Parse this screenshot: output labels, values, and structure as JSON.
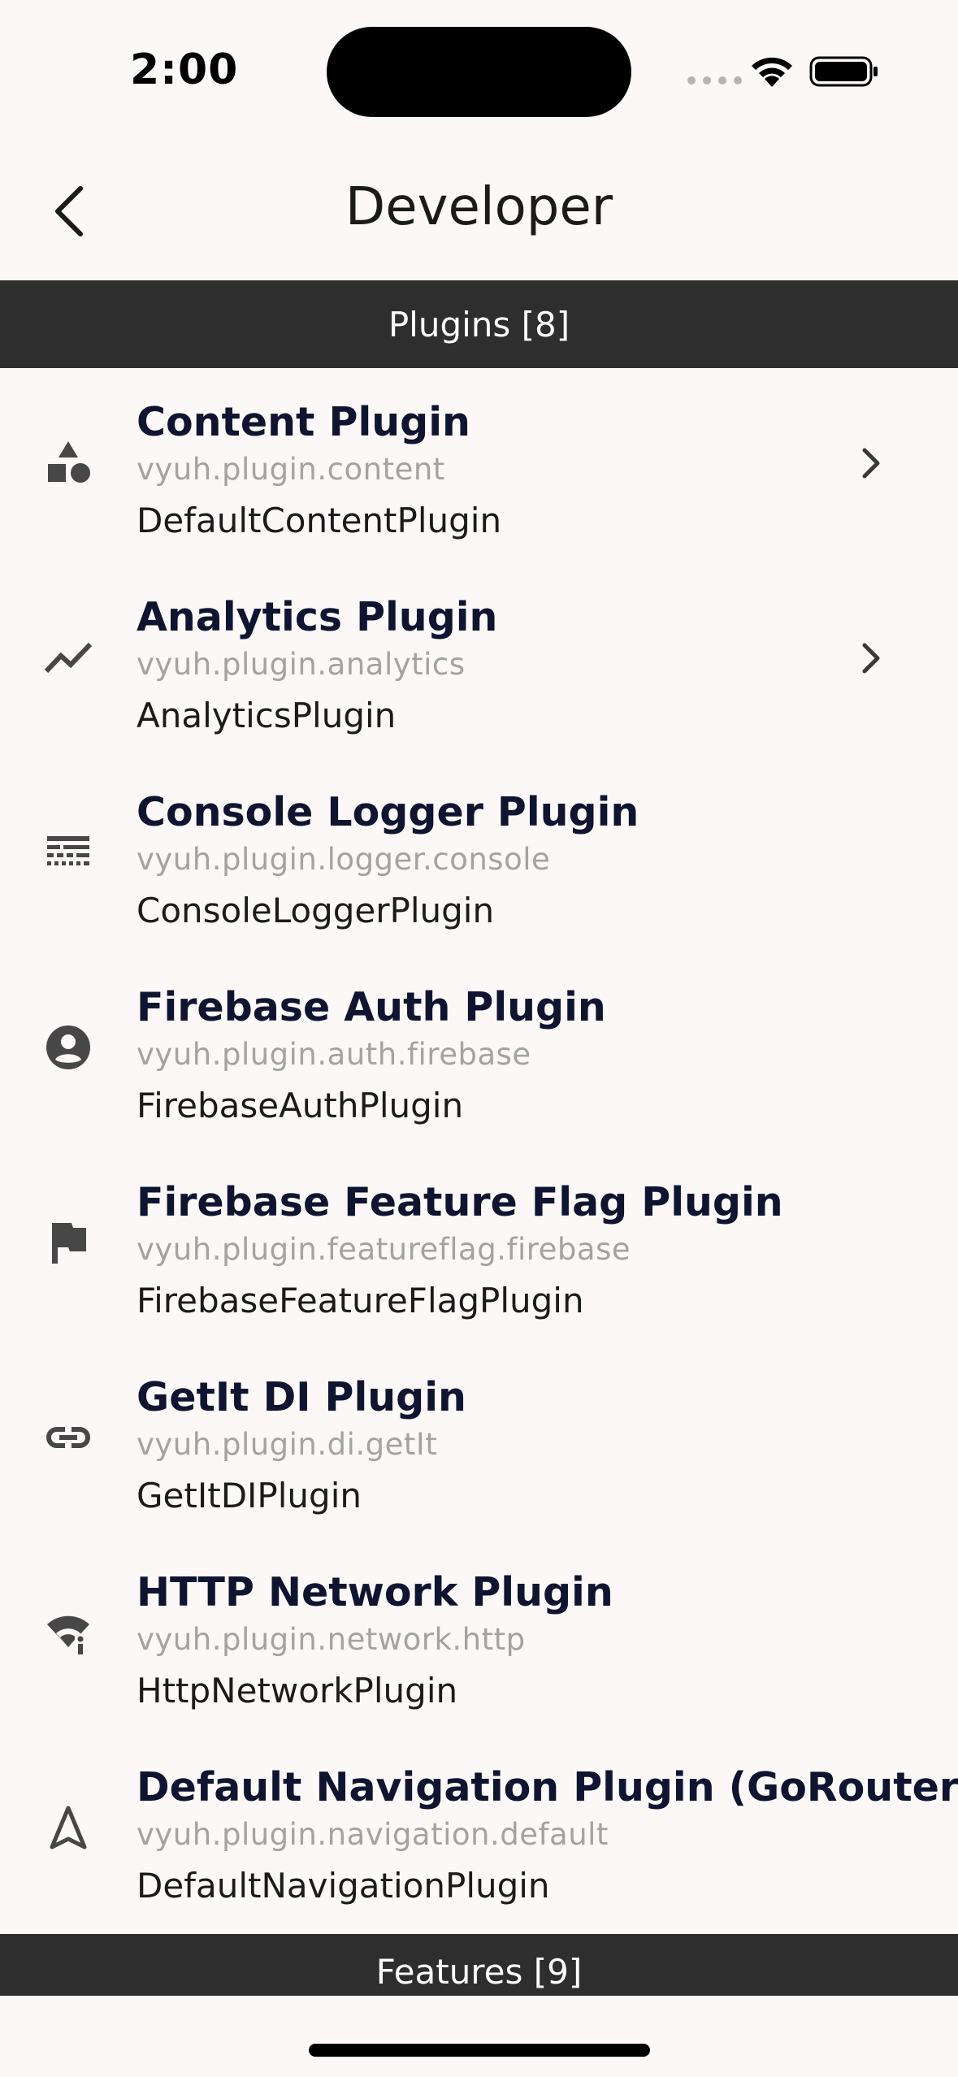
{
  "status_bar": {
    "time": "2:00"
  },
  "app_bar": {
    "title": "Developer",
    "back_icon": "chevron-left-icon"
  },
  "sections": {
    "plugins_header": "Plugins [8]",
    "features_header": "Features [9]"
  },
  "plugins": [
    {
      "title": "Content Plugin",
      "id": "vyuh.plugin.content",
      "class_name": "DefaultContentPlugin",
      "icon": "category-shapes-icon",
      "has_chevron": true
    },
    {
      "title": "Analytics Plugin",
      "id": "vyuh.plugin.analytics",
      "class_name": "AnalyticsPlugin",
      "icon": "trending-line-icon",
      "has_chevron": true
    },
    {
      "title": "Console Logger Plugin",
      "id": "vyuh.plugin.logger.console",
      "class_name": "ConsoleLoggerPlugin",
      "icon": "logs-icon",
      "has_chevron": false
    },
    {
      "title": "Firebase Auth Plugin",
      "id": "vyuh.plugin.auth.firebase",
      "class_name": "FirebaseAuthPlugin",
      "icon": "account-circle-icon",
      "has_chevron": false
    },
    {
      "title": "Firebase Feature Flag Plugin",
      "id": "vyuh.plugin.featureflag.firebase",
      "class_name": "FirebaseFeatureFlagPlugin",
      "icon": "flag-icon",
      "has_chevron": false
    },
    {
      "title": "GetIt DI Plugin",
      "id": "vyuh.plugin.di.getIt",
      "class_name": "GetItDIPlugin",
      "icon": "link-icon",
      "has_chevron": false
    },
    {
      "title": "HTTP Network Plugin",
      "id": "vyuh.plugin.network.http",
      "class_name": "HttpNetworkPlugin",
      "icon": "network-wifi-icon",
      "has_chevron": false
    },
    {
      "title": "Default Navigation Plugin (GoRouter)",
      "id": "vyuh.plugin.navigation.default",
      "class_name": "DefaultNavigationPlugin",
      "icon": "navigation-arrow-icon",
      "has_chevron": false
    }
  ],
  "colors": {
    "background": "#FCF8F7",
    "section_header_bg": "#2E2E2E",
    "title_text": "#0F1530",
    "subtitle_text": "#A3A3A3",
    "icon": "#474747"
  }
}
